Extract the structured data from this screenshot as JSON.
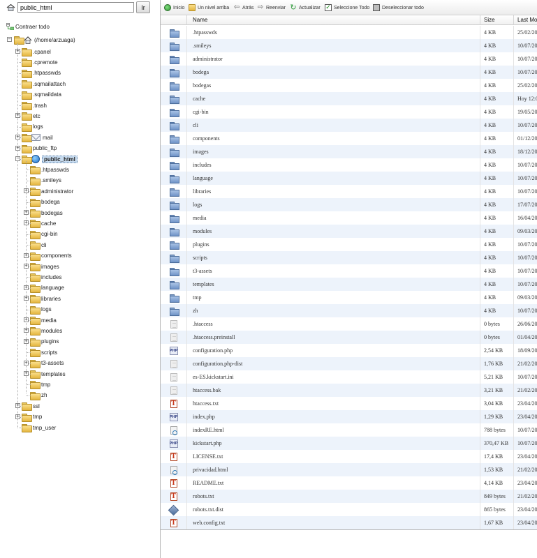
{
  "path_bar": {
    "value": "public_html",
    "go_label": "Ir"
  },
  "tree": {
    "collapse_label": "Contraer todo",
    "root": "(/home/arzuaga)",
    "nodes": [
      {
        "label": ".cpanel",
        "expander": "+"
      },
      {
        "label": ".cpremote",
        "expander": ""
      },
      {
        "label": ".htpasswds",
        "expander": ""
      },
      {
        "label": ".sqmailattach",
        "expander": ""
      },
      {
        "label": ".sqmaildata",
        "expander": ""
      },
      {
        "label": ".trash",
        "expander": ""
      },
      {
        "label": "etc",
        "expander": "+"
      },
      {
        "label": "logs",
        "expander": ""
      },
      {
        "label": "mail",
        "expander": "+"
      },
      {
        "label": "public_ftp",
        "expander": "+"
      },
      {
        "label": "public_html",
        "expander": "−"
      },
      {
        "label": ".htpasswds",
        "expander": ""
      },
      {
        "label": ".smileys",
        "expander": ""
      },
      {
        "label": "administrator",
        "expander": "+"
      },
      {
        "label": "bodega",
        "expander": ""
      },
      {
        "label": "bodegas",
        "expander": "+"
      },
      {
        "label": "cache",
        "expander": "+"
      },
      {
        "label": "cgi-bin",
        "expander": ""
      },
      {
        "label": "cli",
        "expander": ""
      },
      {
        "label": "components",
        "expander": "+"
      },
      {
        "label": "images",
        "expander": "+"
      },
      {
        "label": "includes",
        "expander": ""
      },
      {
        "label": "language",
        "expander": "+"
      },
      {
        "label": "libraries",
        "expander": "+"
      },
      {
        "label": "logs",
        "expander": ""
      },
      {
        "label": "media",
        "expander": "+"
      },
      {
        "label": "modules",
        "expander": "+"
      },
      {
        "label": "plugins",
        "expander": "+"
      },
      {
        "label": "scripts",
        "expander": ""
      },
      {
        "label": "t3-assets",
        "expander": "+"
      },
      {
        "label": "templates",
        "expander": "+"
      },
      {
        "label": "tmp",
        "expander": ""
      },
      {
        "label": "zh",
        "expander": ""
      },
      {
        "label": "ssl",
        "expander": "+"
      },
      {
        "label": "tmp",
        "expander": "+"
      },
      {
        "label": "tmp_user",
        "expander": ""
      }
    ]
  },
  "toolbar": {
    "home": "Inicio",
    "up": "Un nivel arriba",
    "back": "Atrás",
    "forward": "Reenviar",
    "refresh": "Actualizar",
    "select_all": "Seleccione Todo",
    "deselect_all": "Deseleccionar todo"
  },
  "grid": {
    "headers": {
      "name": "Name",
      "size": "Size",
      "modified": "Last Mod"
    },
    "rows": [
      {
        "icon": "folder",
        "name": ".htpasswds",
        "size": "4 KB",
        "date": "25/02/20"
      },
      {
        "icon": "folder",
        "name": ".smileys",
        "size": "4 KB",
        "date": "10/07/20"
      },
      {
        "icon": "folder",
        "name": "administrator",
        "size": "4 KB",
        "date": "10/07/20"
      },
      {
        "icon": "folder",
        "name": "bodega",
        "size": "4 KB",
        "date": "10/07/20"
      },
      {
        "icon": "folder",
        "name": "bodegas",
        "size": "4 KB",
        "date": "25/02/20"
      },
      {
        "icon": "folder",
        "name": "cache",
        "size": "4 KB",
        "date": "Hoy 12:0"
      },
      {
        "icon": "folder",
        "name": "cgi-bin",
        "size": "4 KB",
        "date": "19/05/20"
      },
      {
        "icon": "folder",
        "name": "cli",
        "size": "4 KB",
        "date": "10/07/20"
      },
      {
        "icon": "folder",
        "name": "components",
        "size": "4 KB",
        "date": "01/12/20"
      },
      {
        "icon": "folder",
        "name": "images",
        "size": "4 KB",
        "date": "18/12/20"
      },
      {
        "icon": "folder",
        "name": "includes",
        "size": "4 KB",
        "date": "10/07/20"
      },
      {
        "icon": "folder",
        "name": "language",
        "size": "4 KB",
        "date": "10/07/20"
      },
      {
        "icon": "folder",
        "name": "libraries",
        "size": "4 KB",
        "date": "10/07/20"
      },
      {
        "icon": "folder",
        "name": "logs",
        "size": "4 KB",
        "date": "17/07/20"
      },
      {
        "icon": "folder",
        "name": "media",
        "size": "4 KB",
        "date": "16/04/20"
      },
      {
        "icon": "folder",
        "name": "modules",
        "size": "4 KB",
        "date": "09/03/20"
      },
      {
        "icon": "folder",
        "name": "plugins",
        "size": "4 KB",
        "date": "10/07/20"
      },
      {
        "icon": "folder",
        "name": "scripts",
        "size": "4 KB",
        "date": "10/07/20"
      },
      {
        "icon": "folder",
        "name": "t3-assets",
        "size": "4 KB",
        "date": "10/07/20"
      },
      {
        "icon": "folder",
        "name": "templates",
        "size": "4 KB",
        "date": "10/07/20"
      },
      {
        "icon": "folder",
        "name": "tmp",
        "size": "4 KB",
        "date": "09/03/20"
      },
      {
        "icon": "folder",
        "name": "zh",
        "size": "4 KB",
        "date": "10/07/20"
      },
      {
        "icon": "doc",
        "name": ".htaccess",
        "size": "0 bytes",
        "date": "26/06/20"
      },
      {
        "icon": "doc",
        "name": ".htaccess.preinstall",
        "size": "0 bytes",
        "date": "01/04/20"
      },
      {
        "icon": "php",
        "name": "configuration.php",
        "size": "2,54 KB",
        "date": "18/09/20"
      },
      {
        "icon": "doc",
        "name": "configuration.php-dist",
        "size": "1,76 KB",
        "date": "21/02/20"
      },
      {
        "icon": "doc",
        "name": "es-ES.kickstart.ini",
        "size": "5,21 KB",
        "date": "10/07/20"
      },
      {
        "icon": "doc",
        "name": "htaccess.bak",
        "size": "3,21 KB",
        "date": "21/02/20"
      },
      {
        "icon": "txt",
        "name": "htaccess.txt",
        "size": "3,04 KB",
        "date": "23/04/20"
      },
      {
        "icon": "php",
        "name": "index.php",
        "size": "1,29 KB",
        "date": "23/04/20"
      },
      {
        "icon": "html",
        "name": "indexRE.html",
        "size": "788 bytes",
        "date": "10/07/20"
      },
      {
        "icon": "php",
        "name": "kickstart.php",
        "size": "370,47 KB",
        "date": "10/07/20"
      },
      {
        "icon": "txt",
        "name": "LICENSE.txt",
        "size": "17,4 KB",
        "date": "23/04/20"
      },
      {
        "icon": "html",
        "name": "privacidad.html",
        "size": "1,53 KB",
        "date": "21/02/20"
      },
      {
        "icon": "txt",
        "name": "README.txt",
        "size": "4,14 KB",
        "date": "23/04/20"
      },
      {
        "icon": "txt",
        "name": "robots.txt",
        "size": "849 bytes",
        "date": "21/02/20"
      },
      {
        "icon": "dist",
        "name": "robots.txt.dist",
        "size": "865 bytes",
        "date": "23/04/20"
      },
      {
        "icon": "txt",
        "name": "web.config.txt",
        "size": "1,67 KB",
        "date": "23/04/20"
      }
    ]
  }
}
